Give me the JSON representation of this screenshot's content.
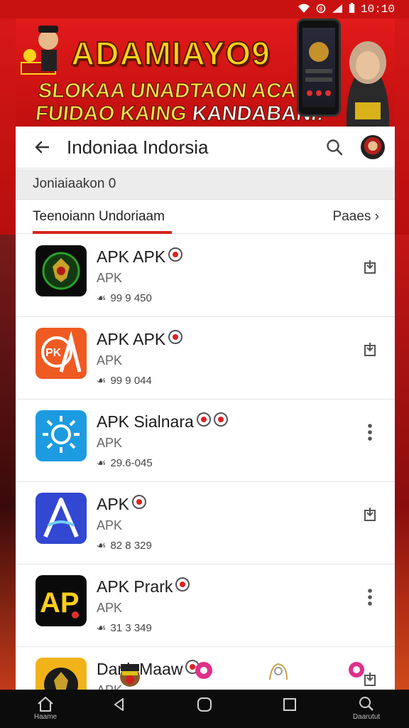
{
  "status": {
    "time": "10:10"
  },
  "banner": {
    "title": "ADAMIAYO9",
    "line1": "SLOKAA UNADTAON ACANLI!",
    "line2_main": "FUIDAO KAING ",
    "line2_accent": "KANDABANI!"
  },
  "appbar": {
    "title": "Indoniaa Indorsia"
  },
  "subheader": {
    "text": "Joniaiaakon 0"
  },
  "tabs": {
    "active": "Teenoiann Undoriaam",
    "more": "Paaes ›"
  },
  "apps": [
    {
      "name": "APK APK",
      "sub": "APK",
      "meta": "99 9 450",
      "action": "download-icon",
      "colors": [
        "#0a0a0a",
        "#1a8a2a"
      ]
    },
    {
      "name": "APK  APK",
      "sub": "APK",
      "meta": "99 9 044",
      "action": "download-icon",
      "colors": [
        "#f0602a",
        "#e23a14"
      ]
    },
    {
      "name": "APK Sialnara",
      "sub": "APK",
      "meta": "29.6-045",
      "action": "more-vert-icon",
      "colors": [
        "#1ea4e6",
        "#0a6fc8"
      ]
    },
    {
      "name": "APK",
      "sub": "APK",
      "meta": "82 8 329",
      "action": "download-icon",
      "colors": [
        "#3a50d8",
        "#2a2aa8"
      ]
    },
    {
      "name": "APK Prark",
      "sub": "APK",
      "meta": "31 3 349",
      "action": "more-vert-icon",
      "colors": [
        "#0a0a0a",
        "#ffd21a"
      ]
    },
    {
      "name": "Dank Maaw",
      "sub": "APK",
      "meta": "",
      "action": "download-icon",
      "colors": [
        "#f6b81a",
        "#d07a10"
      ]
    }
  ],
  "nav": {
    "home_label": "Haame",
    "search_label": "Daarutut"
  }
}
